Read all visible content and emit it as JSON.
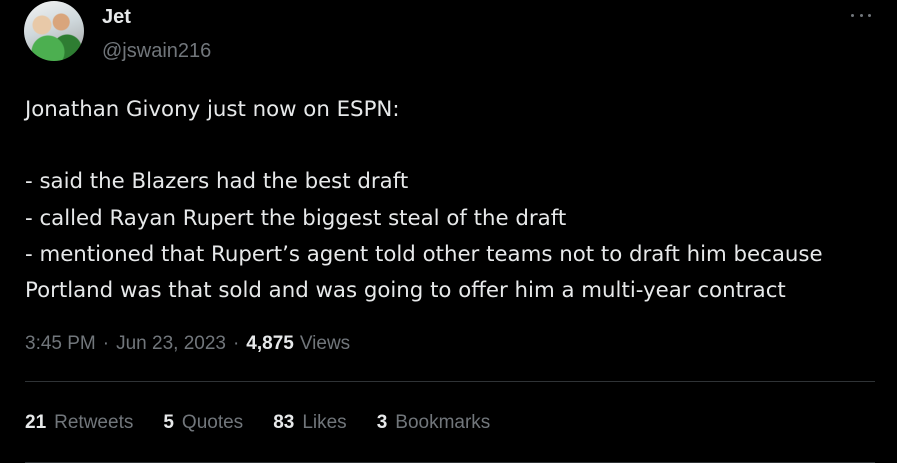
{
  "user": {
    "display_name": "Jet",
    "handle": "@jswain216"
  },
  "tweet": {
    "lines": [
      "Jonathan Givony just now on ESPN:",
      "",
      "- said the Blazers had the best draft",
      "- called Rayan Rupert the biggest steal of the draft",
      "- mentioned that Rupert’s agent told other teams not to draft him because",
      "Portland was that sold and was going to offer him a multi-year contract"
    ]
  },
  "meta": {
    "time": "3:45 PM",
    "separator": "·",
    "date": "Jun 23, 2023",
    "views_count": "4,875",
    "views_label": "Views"
  },
  "stats": [
    {
      "count": "21",
      "label": "Retweets"
    },
    {
      "count": "5",
      "label": "Quotes"
    },
    {
      "count": "83",
      "label": "Likes"
    },
    {
      "count": "3",
      "label": "Bookmarks"
    }
  ],
  "icons": {
    "more": "more-horizontal-icon"
  },
  "colors": {
    "background": "#000000",
    "text_primary": "#e7e9ea",
    "text_secondary": "#71767b",
    "divider": "#2f3336"
  }
}
